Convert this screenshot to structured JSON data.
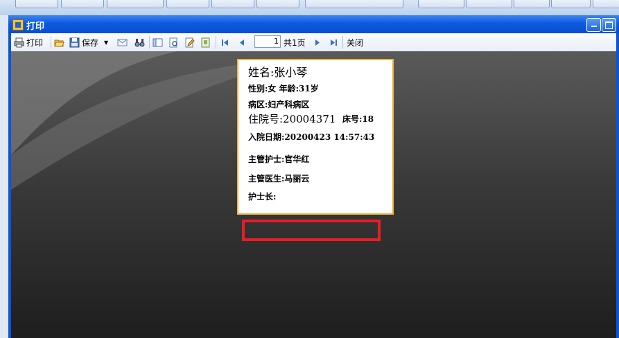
{
  "window": {
    "title": "打印"
  },
  "toolbar": {
    "print_label": "打印",
    "save_label": "保存",
    "page_value": "1",
    "page_total": "共1页",
    "close_label": "关闭"
  },
  "card": {
    "name": "姓名:张小琴",
    "gender_age": "性别:女  年龄:31岁",
    "ward": "病区:妇产科病区",
    "admission_no": "住院号:20004371",
    "bed_no": "床号:18",
    "admit_date": "入院日期:20200423 14:57:43",
    "nurse": "主管护士:官华红",
    "doctor": "主管医生:马丽云",
    "head_nurse": "护士长:"
  },
  "colors": {
    "highlight": "#ec1c24",
    "paper_border": "#f0b43c",
    "titlebar": "#0d5ae0"
  }
}
